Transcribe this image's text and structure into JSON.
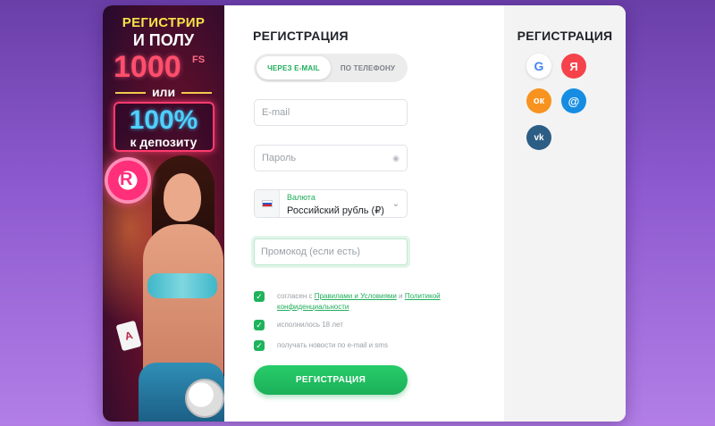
{
  "promo": {
    "line1": "РЕГИСТРИР",
    "line2": "И ПОЛУ",
    "amount": "1000",
    "fs": "FS",
    "or": "или",
    "percent": "100%",
    "deposit": "к депозиту"
  },
  "form": {
    "title": "РЕГИСТРАЦИЯ",
    "tabs": [
      {
        "label": "ЧЕРЕЗ E-MAIL",
        "active": true
      },
      {
        "label": "ПО ТЕЛЕФОНУ",
        "active": false
      }
    ],
    "email_placeholder": "E-mail",
    "password_placeholder": "Пароль",
    "currency": {
      "label": "Валюта",
      "value": "Российский рубль (₽)"
    },
    "promo_placeholder": "Промокод (если есть)",
    "agree": {
      "prefix": "согласен с",
      "terms_link": "Правилами и Условиями",
      "and": "и",
      "privacy_link_1": "Политикой",
      "privacy_link_2": "конфиденциальности"
    },
    "age": "исполнилось 18 лет",
    "news": "получать новости по e-mail и sms",
    "submit_label": "РЕГИСТРАЦИЯ"
  },
  "social": {
    "title": "РЕГИСТРАЦИЯ",
    "items": [
      {
        "name": "google",
        "glyph": "G",
        "color": "#ffffff"
      },
      {
        "name": "yandex",
        "glyph": "Я",
        "color": "#f5424b"
      },
      {
        "name": "odnoklassniki",
        "glyph": "ок",
        "color": "#f7931e"
      },
      {
        "name": "mail-ru",
        "glyph": "@",
        "color": "#168de2"
      },
      {
        "name": "vk",
        "glyph": "vk",
        "color": "#2c5d85"
      }
    ]
  }
}
